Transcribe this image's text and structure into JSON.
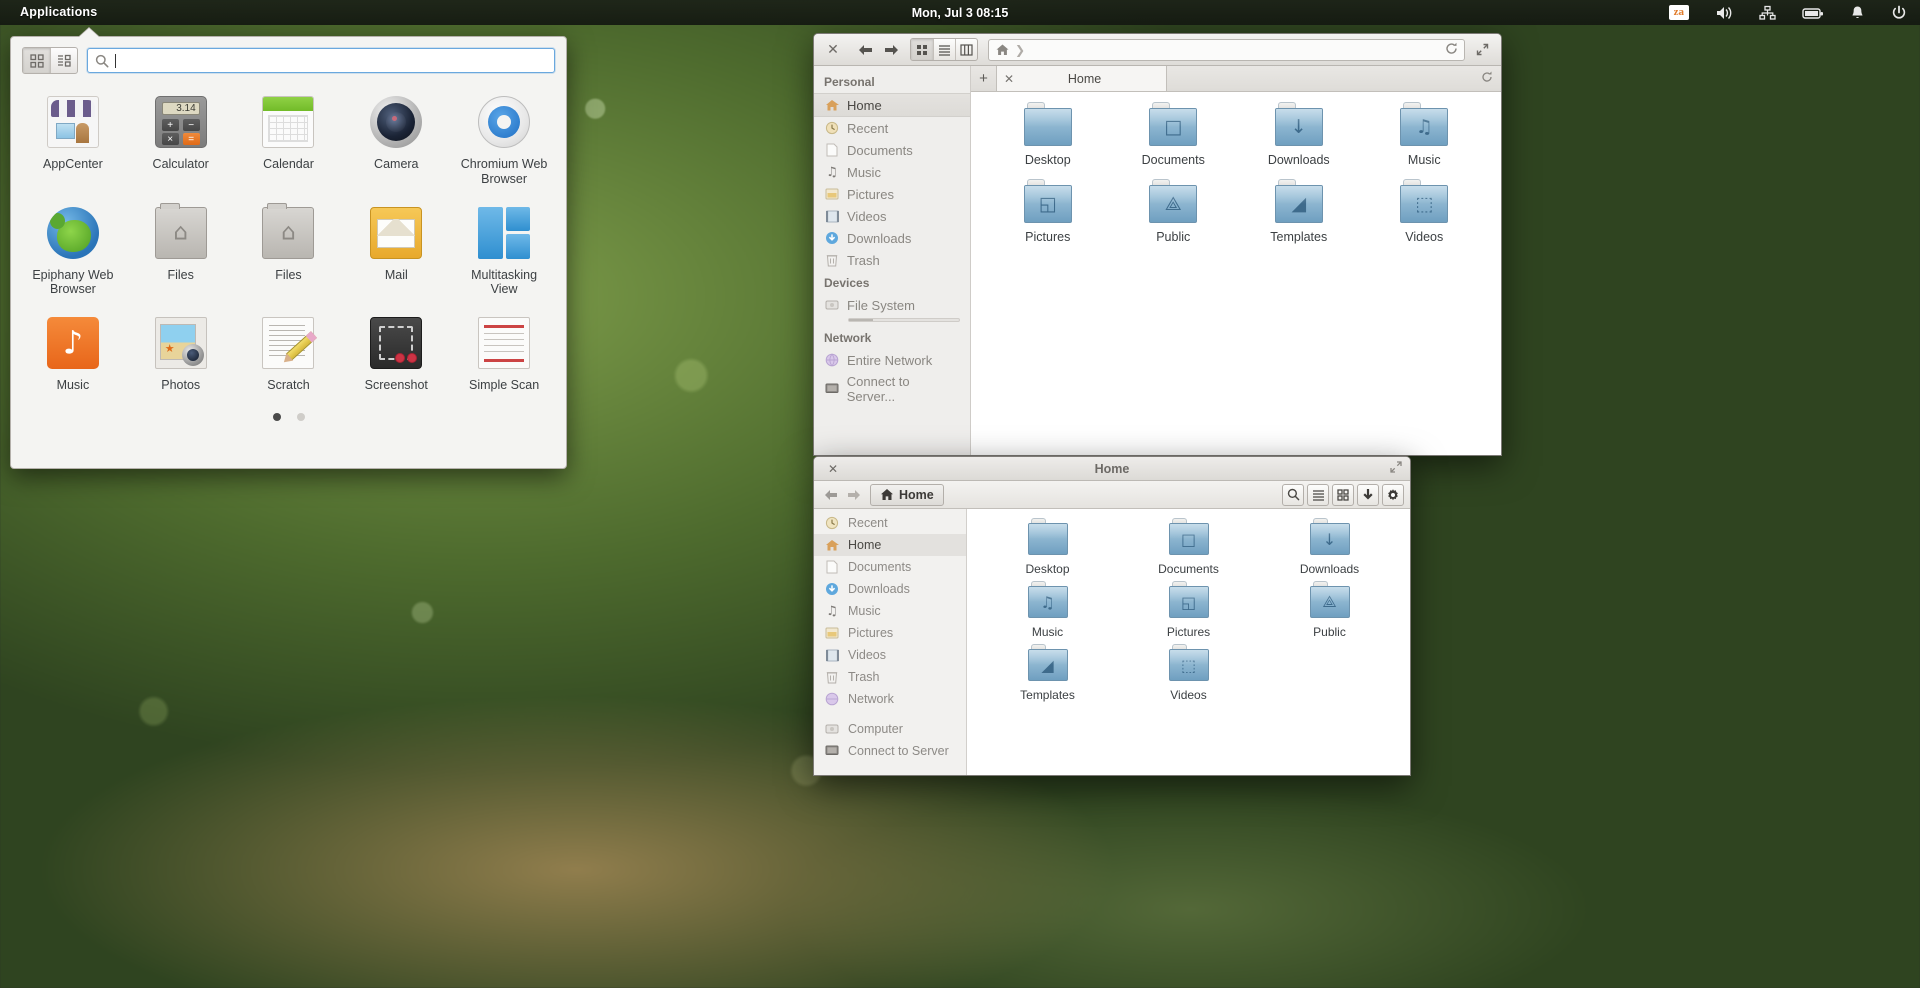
{
  "panel": {
    "applications_label": "Applications",
    "clock": "Mon, Jul  3   08:15",
    "keyboard_layout": "za",
    "indicators": [
      "volume-icon",
      "network-icon",
      "battery-icon",
      "notification-icon",
      "power-icon"
    ]
  },
  "launcher": {
    "view_grid_label": "grid-view",
    "view_category_label": "category-view",
    "search_placeholder": "",
    "search_value": "",
    "apps": [
      {
        "name": "AppCenter",
        "icon": "appcenter-icon"
      },
      {
        "name": "Calculator",
        "icon": "calculator-icon",
        "display": "3.14",
        "keys": [
          "+",
          "−",
          "×",
          "="
        ]
      },
      {
        "name": "Calendar",
        "icon": "calendar-icon"
      },
      {
        "name": "Camera",
        "icon": "camera-icon"
      },
      {
        "name": "Chromium Web Browser",
        "icon": "chromium-icon"
      },
      {
        "name": "Epiphany Web Browser",
        "icon": "epiphany-icon"
      },
      {
        "name": "Files",
        "icon": "files-icon"
      },
      {
        "name": "Files",
        "icon": "files-icon"
      },
      {
        "name": "Mail",
        "icon": "mail-icon"
      },
      {
        "name": "Multitasking View",
        "icon": "multitasking-icon"
      },
      {
        "name": "Music",
        "icon": "music-icon"
      },
      {
        "name": "Photos",
        "icon": "photos-icon"
      },
      {
        "name": "Scratch",
        "icon": "scratch-icon"
      },
      {
        "name": "Screenshot",
        "icon": "screenshot-icon"
      },
      {
        "name": "Simple Scan",
        "icon": "simple-scan-icon"
      }
    ],
    "pages": {
      "count": 2,
      "current": 1
    }
  },
  "files_window": {
    "title": "Home",
    "tab_label": "Home",
    "path_root": "home-icon",
    "view_modes": [
      "icon-view",
      "list-view",
      "column-view"
    ],
    "active_view": "icon-view",
    "sidebar": [
      {
        "group": "Personal",
        "items": [
          {
            "label": "Home",
            "icon": "home-icon",
            "selected": true
          },
          {
            "label": "Recent",
            "icon": "recent-icon",
            "selected": false
          },
          {
            "label": "Documents",
            "icon": "documents-icon",
            "selected": false
          },
          {
            "label": "Music",
            "icon": "music-icon",
            "selected": false
          },
          {
            "label": "Pictures",
            "icon": "pictures-icon",
            "selected": false
          },
          {
            "label": "Videos",
            "icon": "videos-icon",
            "selected": false
          },
          {
            "label": "Downloads",
            "icon": "downloads-icon",
            "selected": false
          },
          {
            "label": "Trash",
            "icon": "trash-icon",
            "selected": false
          }
        ]
      },
      {
        "group": "Devices",
        "items": [
          {
            "label": "File System",
            "icon": "drive-icon",
            "selected": false,
            "capacity": true
          }
        ]
      },
      {
        "group": "Network",
        "items": [
          {
            "label": "Entire Network",
            "icon": "network-icon",
            "selected": false
          },
          {
            "label": "Connect to Server...",
            "icon": "server-icon",
            "selected": false
          }
        ]
      }
    ],
    "folders": [
      {
        "name": "Desktop",
        "emblem": ""
      },
      {
        "name": "Documents",
        "emblem": "□"
      },
      {
        "name": "Downloads",
        "emblem": "↓"
      },
      {
        "name": "Music",
        "emblem": "♫"
      },
      {
        "name": "Pictures",
        "emblem": "◱"
      },
      {
        "name": "Public",
        "emblem": "⟁"
      },
      {
        "name": "Templates",
        "emblem": "◢"
      },
      {
        "name": "Videos",
        "emblem": "⬚"
      }
    ]
  },
  "nautilus_window": {
    "title": "Home",
    "breadcrumb": "Home",
    "toolbar_icons": [
      "search-icon",
      "list-view-icon",
      "grid-view-icon",
      "download-icon",
      "gear-icon"
    ],
    "sidebar": [
      {
        "label": "Recent",
        "icon": "recent-icon",
        "selected": false
      },
      {
        "label": "Home",
        "icon": "home-icon",
        "selected": true
      },
      {
        "label": "Documents",
        "icon": "documents-icon",
        "selected": false
      },
      {
        "label": "Downloads",
        "icon": "downloads-icon",
        "selected": false
      },
      {
        "label": "Music",
        "icon": "music-icon",
        "selected": false
      },
      {
        "label": "Pictures",
        "icon": "pictures-icon",
        "selected": false
      },
      {
        "label": "Videos",
        "icon": "videos-icon",
        "selected": false
      },
      {
        "label": "Trash",
        "icon": "trash-icon",
        "selected": false
      },
      {
        "label": "Network",
        "icon": "network-icon",
        "selected": false
      },
      {
        "label": "Computer",
        "icon": "computer-icon",
        "selected": false,
        "spaced": true
      },
      {
        "label": "Connect to Server",
        "icon": "server-icon",
        "selected": false
      }
    ],
    "folders": [
      {
        "name": "Desktop",
        "emblem": ""
      },
      {
        "name": "Documents",
        "emblem": "□"
      },
      {
        "name": "Downloads",
        "emblem": "↓"
      },
      {
        "name": "Music",
        "emblem": "♫"
      },
      {
        "name": "Pictures",
        "emblem": "◱"
      },
      {
        "name": "Public",
        "emblem": "⟁"
      },
      {
        "name": "Templates",
        "emblem": "◢"
      },
      {
        "name": "Videos",
        "emblem": "⬚"
      }
    ]
  },
  "colors": {
    "panel_bg": "#1c2218",
    "accent_blue": "#6aa8de",
    "folder_blue": "#6f9fc0",
    "launcher_bg": "#f4f4f2"
  }
}
